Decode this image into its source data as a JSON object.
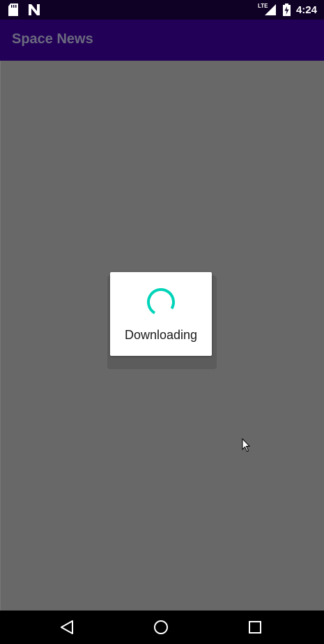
{
  "status_bar": {
    "time": "4:24",
    "network_label": "LTE",
    "icons_left": [
      "sd-card-icon",
      "n-notification-icon"
    ],
    "icons_right": [
      "signal-icon",
      "battery-charging-icon"
    ]
  },
  "app_bar": {
    "title": "Space News"
  },
  "dialog": {
    "message": "Downloading",
    "spinner_color": "#00d4b8"
  },
  "nav_bar": {
    "buttons": [
      "back-icon",
      "home-icon",
      "recents-icon"
    ]
  },
  "colors": {
    "status_bar_bg": "#0f0025",
    "app_bar_bg": "#230058",
    "title_text": "#6a6a7e",
    "scrim": "#686868"
  }
}
